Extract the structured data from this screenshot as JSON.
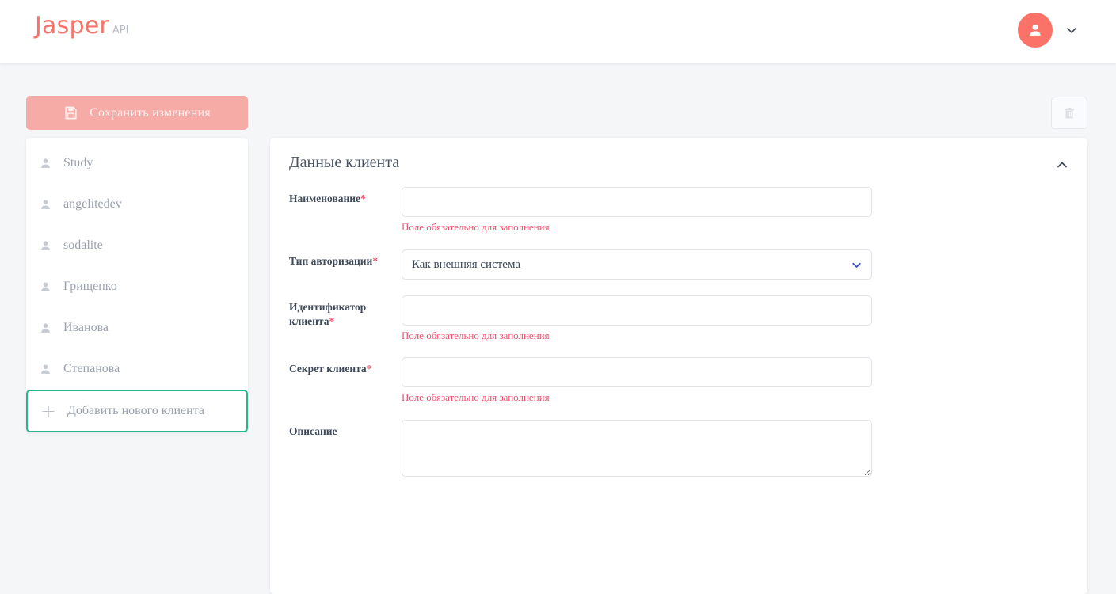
{
  "header": {
    "brand_name": "Jasper",
    "brand_sub": "API",
    "avatar_icon": "user-avatar-icon",
    "chevron_icon": "chevron-down-icon"
  },
  "toolbar": {
    "save_label": "Сохранить изменения",
    "save_icon": "save-floppy-icon",
    "delete_icon": "trash-icon"
  },
  "sidebar": {
    "clients": [
      {
        "name": "Study",
        "icon": "person-icon"
      },
      {
        "name": "angelitedev",
        "icon": "person-icon"
      },
      {
        "name": "sodalite",
        "icon": "person-icon"
      },
      {
        "name": "Грищенко",
        "icon": "person-icon"
      },
      {
        "name": "Иванова",
        "icon": "person-icon"
      },
      {
        "name": "Степанова",
        "icon": "person-icon"
      }
    ],
    "add_client_label": "Добавить нового клиента",
    "add_client_icon": "plus-icon",
    "add_client_border_color": "#23b68a"
  },
  "card": {
    "title": "Данные клиента",
    "collapse_icon": "chevron-up-icon"
  },
  "form": {
    "required_mark": "*",
    "error_text": "Поле обязательно для заполнения",
    "fields": {
      "name": {
        "label": "Наименование",
        "value": "",
        "placeholder": ""
      },
      "auth_type": {
        "label": "Тип авторизации",
        "value": "Как внешняя система",
        "chevron_icon": "chevron-down-icon"
      },
      "client_id": {
        "label": "Идентификатор клиента",
        "value": "",
        "placeholder": ""
      },
      "client_secret": {
        "label": "Секрет клиента",
        "value": "",
        "placeholder": ""
      },
      "description": {
        "label": "Описание",
        "value": "",
        "placeholder": ""
      }
    }
  },
  "colors": {
    "brand": "#fa7268",
    "accent_green": "#23b68a",
    "error": "#f0506e",
    "select_chevron": "#3a4fc4",
    "page_bg": "#f5f6f8"
  }
}
